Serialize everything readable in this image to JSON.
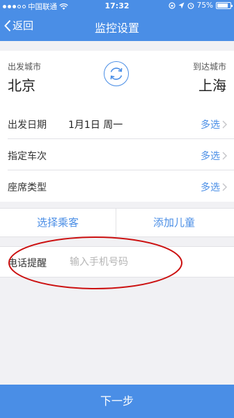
{
  "status_bar": {
    "carrier": "中国联通",
    "time": "17:32",
    "battery": "75%",
    "battery_level": 0.75
  },
  "nav": {
    "back_label": "返回",
    "title": "监控设置"
  },
  "cities": {
    "from_label": "出发城市",
    "from_city": "北京",
    "to_label": "到达城市",
    "to_city": "上海",
    "swap_icon": "swap-arrows-icon"
  },
  "rows": {
    "date": {
      "label": "出发日期",
      "value": "1月1日 周一",
      "action": "多选"
    },
    "train": {
      "label": "指定车次",
      "action": "多选"
    },
    "seat": {
      "label": "座席类型",
      "action": "多选"
    }
  },
  "passengers": {
    "select_label": "选择乘客",
    "add_child_label": "添加儿童"
  },
  "phone": {
    "label": "电话提醒",
    "placeholder": "输入手机号码"
  },
  "next_label": "下一步",
  "colors": {
    "accent": "#4a8ee6",
    "annotation": "#cc1111",
    "background": "#f1f1f4"
  }
}
